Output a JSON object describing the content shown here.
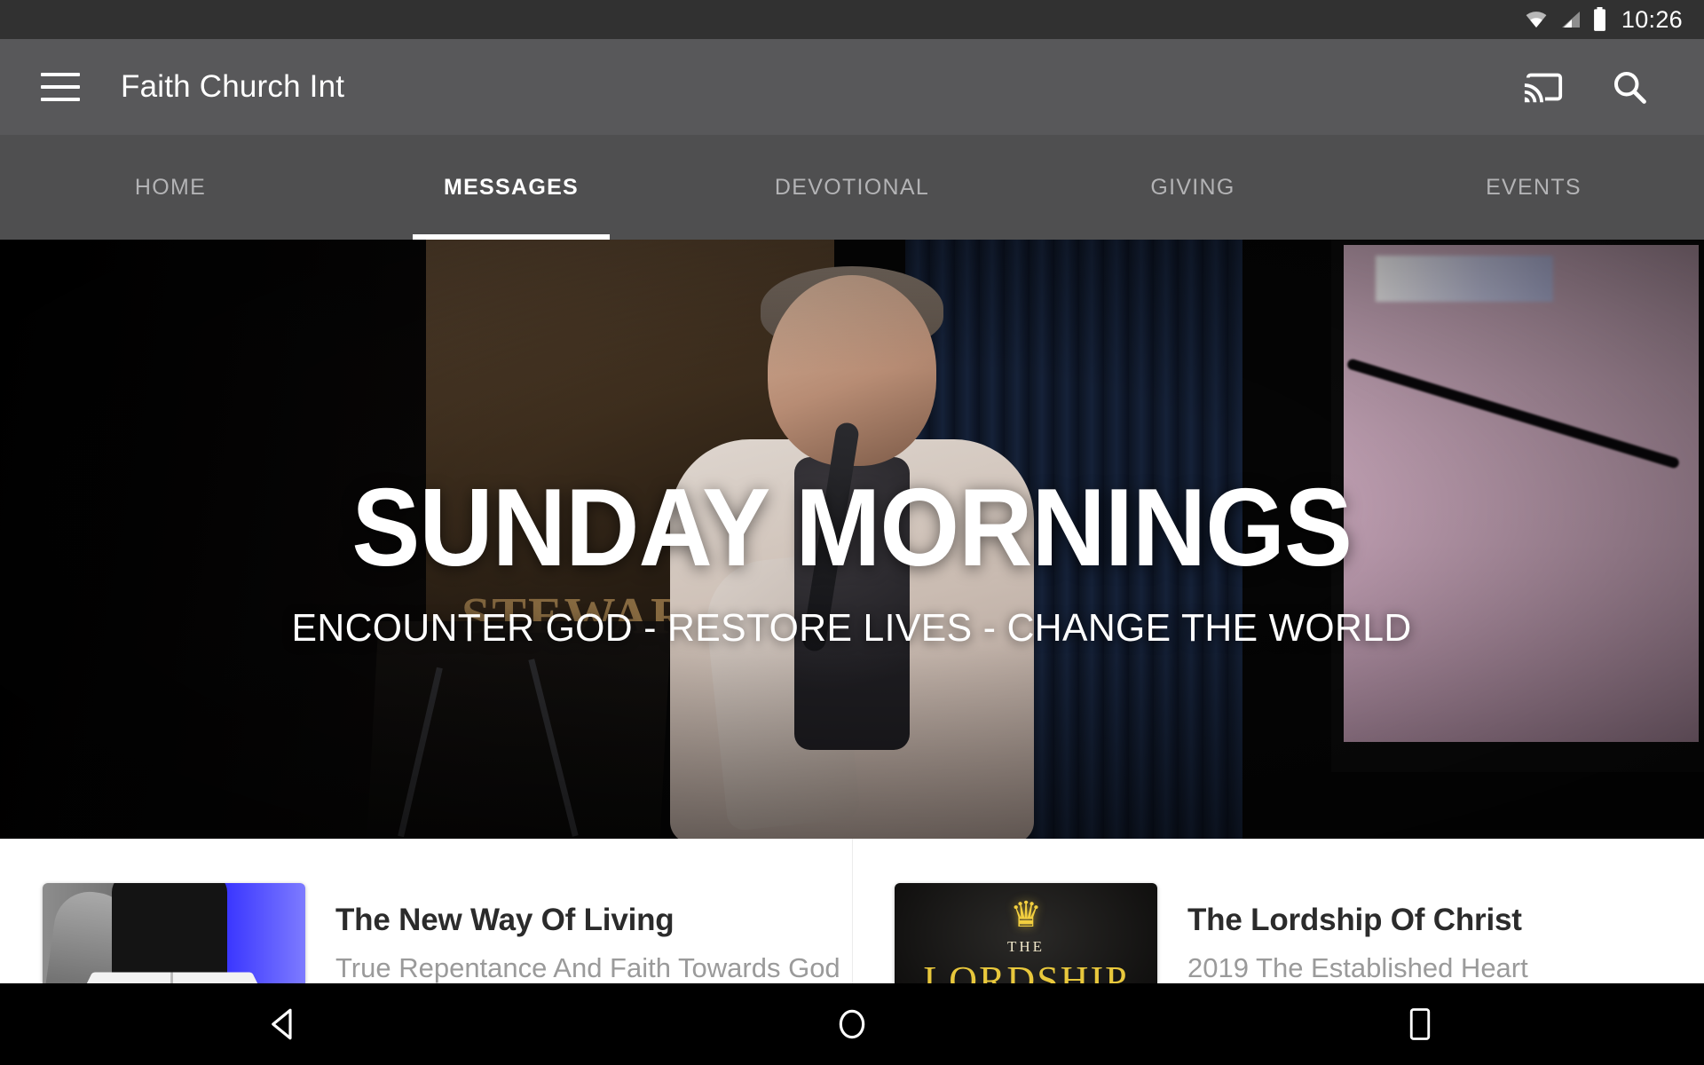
{
  "status_bar": {
    "time": "10:26",
    "icons": [
      "wifi-icon",
      "cellular-signal-icon",
      "battery-icon"
    ],
    "background": "#313131"
  },
  "app_bar": {
    "menu_icon": "hamburger-menu-icon",
    "title": "Faith Church Int",
    "actions": [
      {
        "name": "cast-icon",
        "label": "Cast"
      },
      {
        "name": "search-icon",
        "label": "Search"
      }
    ],
    "background": "#58585a"
  },
  "tabs": {
    "active_index": 1,
    "items": [
      {
        "label": "HOME"
      },
      {
        "label": "MESSAGES"
      },
      {
        "label": "DEVOTIONAL"
      },
      {
        "label": "GIVING"
      },
      {
        "label": "EVENTS"
      }
    ],
    "indicator_color": "#ffffff",
    "active_color": "#ffffff",
    "inactive_color": "#b3b3b5"
  },
  "hero": {
    "title": "SUNDAY MORNINGS",
    "subtitle": "ENCOUNTER GOD - RESTORE LIVES - CHANGE THE WORLD",
    "image_description": "Man speaking into a handheld microphone on a stage with a projector screen"
  },
  "messages_list": [
    {
      "title": "The New Way Of Living",
      "subtitle": "True Repentance And Faith Towards God",
      "thumbnail": "person-holding-open-book-thumbnail"
    },
    {
      "title": "The Lordship Of Christ",
      "subtitle": "2019 The Established Heart",
      "thumbnail": "lordship-crown-thumbnail",
      "thumbnail_text": {
        "crown": "♛",
        "line1": "THE",
        "line2": "LORDSHIP"
      }
    }
  ],
  "nav_bar": {
    "buttons": [
      {
        "name": "back-button",
        "label": "Back"
      },
      {
        "name": "home-button",
        "label": "Home"
      },
      {
        "name": "recents-button",
        "label": "Recents"
      }
    ],
    "background": "#000000"
  }
}
